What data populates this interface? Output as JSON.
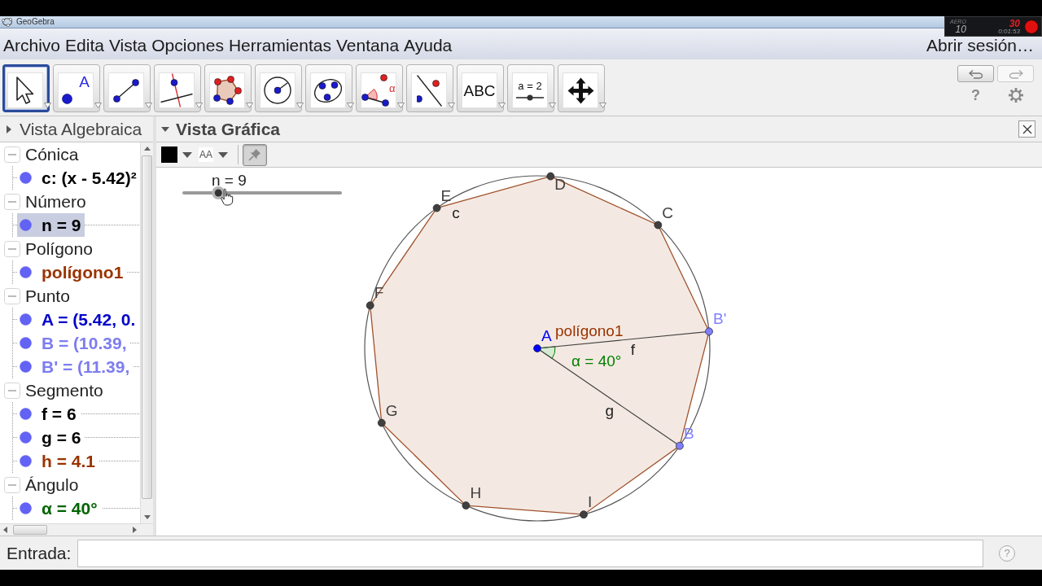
{
  "title_bar": {
    "title": "GeoGebra"
  },
  "recorder": {
    "mode": "AERO",
    "fps_limit": "10",
    "fps": "30",
    "elapsed": "0:01:53",
    "recording": true
  },
  "menu": {
    "items": [
      "Archivo",
      "Edita",
      "Vista",
      "Opciones",
      "Herramientas",
      "Ventana",
      "Ayuda"
    ],
    "sign_in": "Abrir sesión…"
  },
  "toolbar": {
    "tools": [
      {
        "kind": "move",
        "selected": true
      },
      {
        "kind": "point",
        "text": "A",
        "selected": false
      },
      {
        "kind": "segment",
        "selected": false
      },
      {
        "kind": "perpendicular",
        "selected": false
      },
      {
        "kind": "polygon",
        "selected": false
      },
      {
        "kind": "circle",
        "selected": false
      },
      {
        "kind": "conic",
        "selected": false
      },
      {
        "kind": "angle",
        "text": "α",
        "selected": false
      },
      {
        "kind": "reflect",
        "selected": false
      },
      {
        "kind": "text",
        "text": "ABC",
        "selected": false
      },
      {
        "kind": "slider",
        "text": "a = 2",
        "selected": false
      },
      {
        "kind": "pan",
        "selected": false
      }
    ],
    "undo": {
      "disabled": false
    },
    "redo": {
      "disabled": true
    },
    "help": "?"
  },
  "algebra_view": {
    "title": "Vista Algebraica",
    "expanded": false,
    "groups": [
      {
        "label": "Cónica",
        "expanded": true,
        "items": [
          {
            "text": "c: (x - 5.42)²",
            "color": "#000000",
            "visible": true,
            "selected": false
          }
        ]
      },
      {
        "label": "Número",
        "expanded": true,
        "items": [
          {
            "text": "n = 9",
            "color": "#000000",
            "visible": true,
            "selected": true
          }
        ]
      },
      {
        "label": "Polígono",
        "expanded": true,
        "items": [
          {
            "text": "polígono1",
            "color": "#993300",
            "visible": true,
            "selected": false
          }
        ]
      },
      {
        "label": "Punto",
        "expanded": true,
        "items": [
          {
            "text": "A = (5.42, 0.",
            "color": "#0000cc",
            "visible": true,
            "selected": false
          },
          {
            "text": "B = (10.39,",
            "color": "#7d7df0",
            "visible": true,
            "selected": false
          },
          {
            "text": "B' = (11.39,",
            "color": "#7d7df0",
            "visible": true,
            "selected": false
          }
        ]
      },
      {
        "label": "Segmento",
        "expanded": true,
        "items": [
          {
            "text": "f = 6",
            "color": "#000000",
            "visible": true,
            "selected": false
          },
          {
            "text": "g = 6",
            "color": "#000000",
            "visible": true,
            "selected": false
          },
          {
            "text": "h = 4.1",
            "color": "#993300",
            "visible": true,
            "selected": false
          }
        ]
      },
      {
        "label": "Ángulo",
        "expanded": true,
        "items": [
          {
            "text": "α = 40°",
            "color": "#006400",
            "visible": true,
            "selected": false
          }
        ]
      }
    ]
  },
  "graphics_view": {
    "title": "Vista Gráfica",
    "expanded": true,
    "style_bar": {
      "color": "#000000",
      "label_style": "AA",
      "pinned": true
    },
    "canvas": {
      "slider": {
        "label": "n = 9",
        "level": 0.22
      },
      "circle": {
        "label": "c"
      },
      "center": {
        "label": "A",
        "color": "#0000ff"
      },
      "vertices": [
        {
          "label": "D",
          "color": "#404040"
        },
        {
          "label": "C",
          "color": "#404040"
        },
        {
          "label": "B'",
          "color": "#7f7fff",
          "segment": "f"
        },
        {
          "label": "B",
          "color": "#7f7fff",
          "segment": "g"
        },
        {
          "label": "I",
          "color": "#404040"
        },
        {
          "label": "H",
          "color": "#404040"
        },
        {
          "label": "G",
          "color": "#404040"
        },
        {
          "label": "F",
          "color": "#404040"
        },
        {
          "label": "E",
          "color": "#404040"
        }
      ],
      "polygon": {
        "label": "polígono1"
      },
      "angle": {
        "label": "α = 40°"
      }
    }
  },
  "input_bar": {
    "label": "Entrada:",
    "help": "?"
  }
}
